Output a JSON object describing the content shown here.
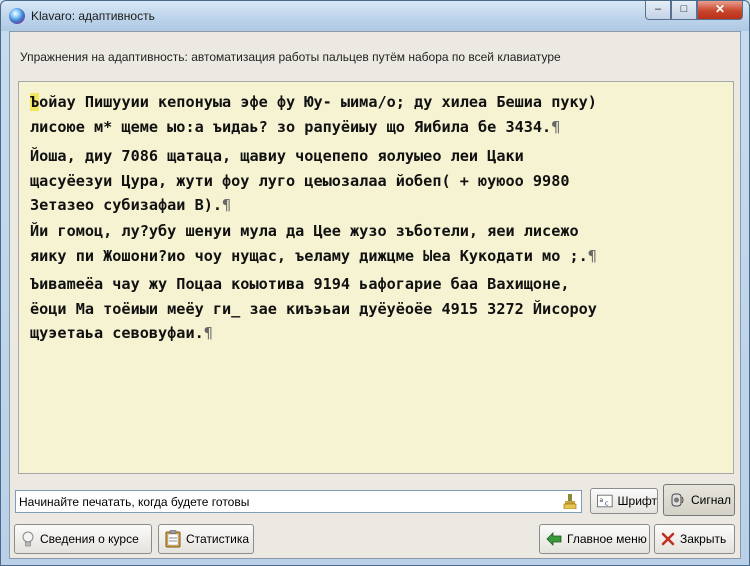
{
  "window": {
    "title": "Klavaro: адаптивность",
    "controls": {
      "minimize": "–",
      "maximize": "□",
      "close": "✕"
    }
  },
  "exercise": {
    "title": "Упражнения на адаптивность: автоматизация работы пальцев путём набора по всей клавиатуре",
    "first_char": "Ъ",
    "paragraphs": [
      {
        "line1_rest": "ойау Пишууии кепонуыа эфе фу Юу- ыима/о; ду хилеа Бешиа пуку)",
        "line2": "лисоюе м* щеме ыо:а ъидаь? зо рапуёиыу що Яибила бе 3434."
      },
      {
        "line1": "Йоша, диу 7086 щатаца, щавиу чоцепепо яолуыео леи Цаки",
        "line2": "щасуёезуи Цура, жути фоу луго цеыозалаа йобеп( + юуюоо 9980",
        "line3": "Зетазео субизафаи В)."
      },
      {
        "line1": "Йи гомоц, лу?убу шенуи мула да Цее жузо зъботели, яеи лисежо",
        "line2": "яику пи Жошони?ио чоу нущас, ъеламу дижцме Ыеа Кукодати мо ;."
      },
      {
        "line1": "Ъиваmeёа чау жу Поцаа коыотива 9194 ьафогарие баа Вахищоне,",
        "line2": "ёоци Ма тоёиыи меёу ги_ зае киъэьаи дуёуёоёе 4915 3272 Йисороу",
        "line3": "щуэетаьа севовуфаи."
      }
    ],
    "pilcrow": "¶"
  },
  "input": {
    "value": "Начинайте печатать, когда будете готовы"
  },
  "buttons": {
    "font": "Шрифт",
    "signal": "Сигнал",
    "course_info": "Сведения о курсе",
    "statistics": "Статистика",
    "main_menu": "Главное меню",
    "close": "Закрыть"
  }
}
